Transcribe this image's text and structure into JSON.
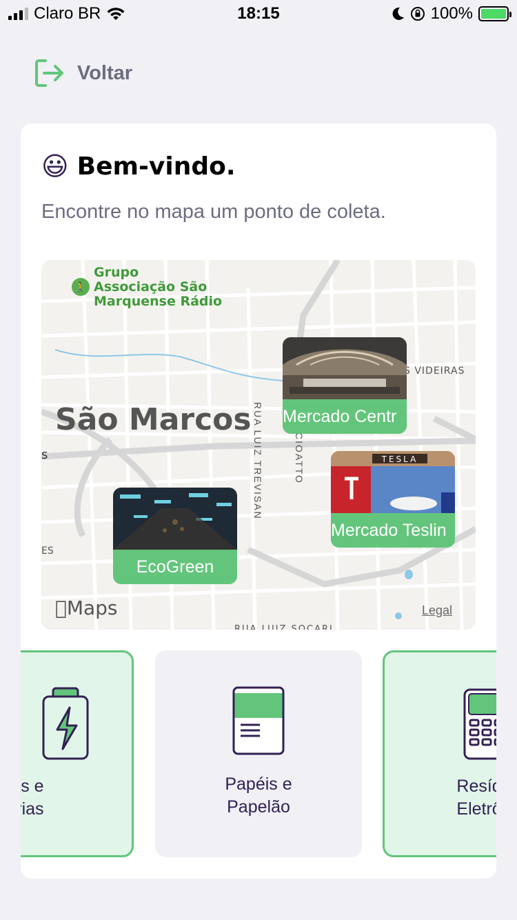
{
  "status": {
    "carrier": "Claro BR",
    "time": "18:15",
    "battery": "100%",
    "battery_level": 1.0
  },
  "header": {
    "back_label": "Voltar",
    "back_icon": "logout-arrow-icon"
  },
  "welcome": {
    "emoji": "😃",
    "title": "Bem-vindo.",
    "subtitle": "Encontre no mapa um ponto de coleta."
  },
  "map": {
    "city": "São Marcos",
    "poi": [
      "Grupo",
      "Associação São",
      "Marquense Rádio"
    ],
    "streets": {
      "luiz_trevisan": "RUA LUIZ TREVISAN",
      "ciatto": "CIOATTO",
      "videiras": "S VIDEIRAS",
      "es": "ES",
      "s": "s",
      "bottom": "RUA LUIZ SOCARI"
    },
    "maps_logo": "Maps",
    "legal": "Legal",
    "markers": [
      {
        "name": "Mercado Central",
        "label_visible": "Mercado Centr"
      },
      {
        "name": "Mercado Teslin",
        "label_visible": "Mercado Teslin"
      },
      {
        "name": "EcoGreen",
        "label_visible": "EcoGreen"
      }
    ]
  },
  "items": [
    {
      "title_line1": "has e",
      "title_line2": "terias",
      "icon": "battery-icon",
      "selected": true
    },
    {
      "title_line1": "Papéis e",
      "title_line2": "Papelão",
      "icon": "paper-icon",
      "selected": false
    },
    {
      "title_line1": "Resídu",
      "title_line2": "Eletrôn",
      "icon": "electronics-icon",
      "selected": true
    }
  ],
  "colors": {
    "green": "#63c57b",
    "green_light": "#e1f5e9",
    "text_dark": "#322153",
    "text_gray": "#6c6c80",
    "background": "#f0f0f5"
  }
}
